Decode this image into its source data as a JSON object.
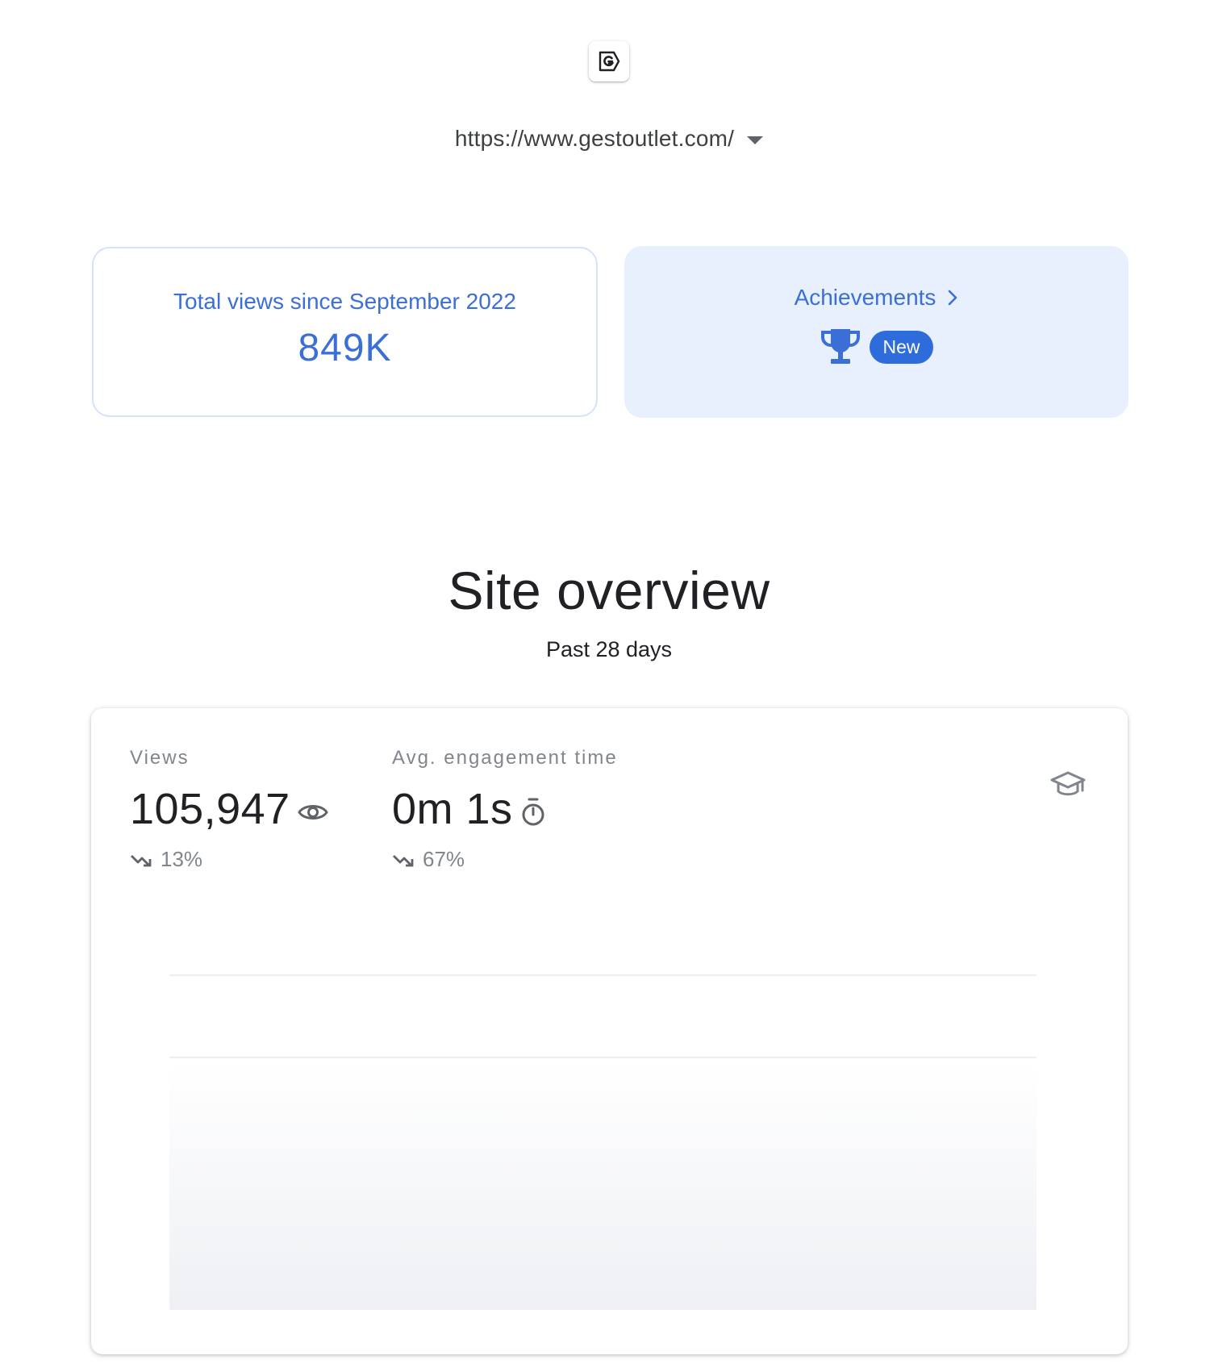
{
  "site": {
    "url": "https://www.gestoutlet.com/"
  },
  "total_views": {
    "label": "Total views since September 2022",
    "value": "849K"
  },
  "achievements": {
    "title": "Achievements",
    "badge": "New"
  },
  "overview": {
    "title": "Site overview",
    "subtitle": "Past 28 days",
    "metrics": [
      {
        "label": "Views",
        "value": "105,947",
        "icon": "eye-icon",
        "change": "13%",
        "trend": "down"
      },
      {
        "label": "Avg. engagement time",
        "value": "0m 1s",
        "icon": "timer-icon",
        "change": "67%",
        "trend": "down"
      }
    ]
  },
  "colors": {
    "accent": "#3b6fd6",
    "achievement_bg": "#e8f0fe",
    "badge_bg": "#2f6cdb",
    "muted_text": "#80868b"
  }
}
